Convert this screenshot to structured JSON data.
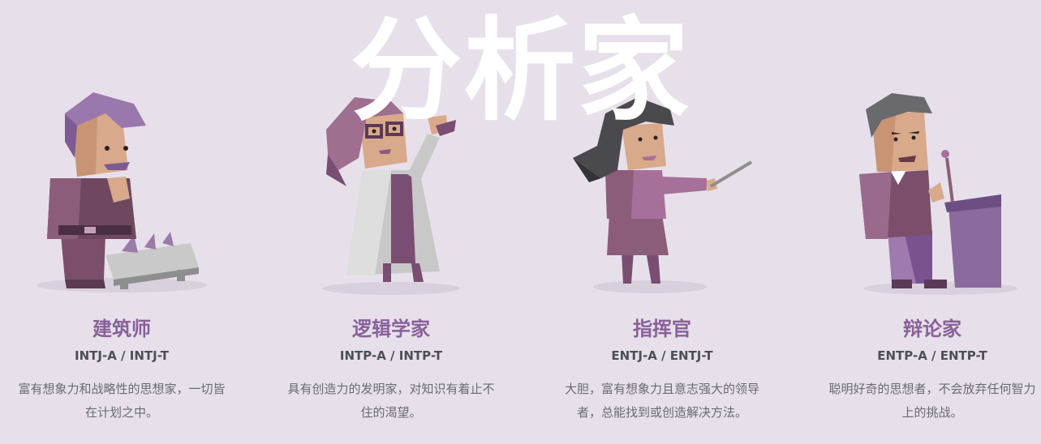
{
  "group": {
    "title": "分析家"
  },
  "colors": {
    "accent": "#88619a",
    "background": "#e7e0ea",
    "title": "#ffffff"
  },
  "personalities": [
    {
      "name": "建筑师",
      "code": "INTJ-A / INTJ-T",
      "description": "富有想象力和战略性的思想家，一切皆在计划之中。",
      "illustration": "architect-illustration"
    },
    {
      "name": "逻辑学家",
      "code": "INTP-A / INTP-T",
      "description": "具有创造力的发明家，对知识有着止不住的渴望。",
      "illustration": "logician-illustration"
    },
    {
      "name": "指挥官",
      "code": "ENTJ-A / ENTJ-T",
      "description": "大胆，富有想象力且意志强大的领导者，总能找到或创造解决方法。",
      "illustration": "commander-illustration"
    },
    {
      "name": "辩论家",
      "code": "ENTP-A / ENTP-T",
      "description": "聪明好奇的思想者，不会放弃任何智力上的挑战。",
      "illustration": "debater-illustration"
    }
  ]
}
